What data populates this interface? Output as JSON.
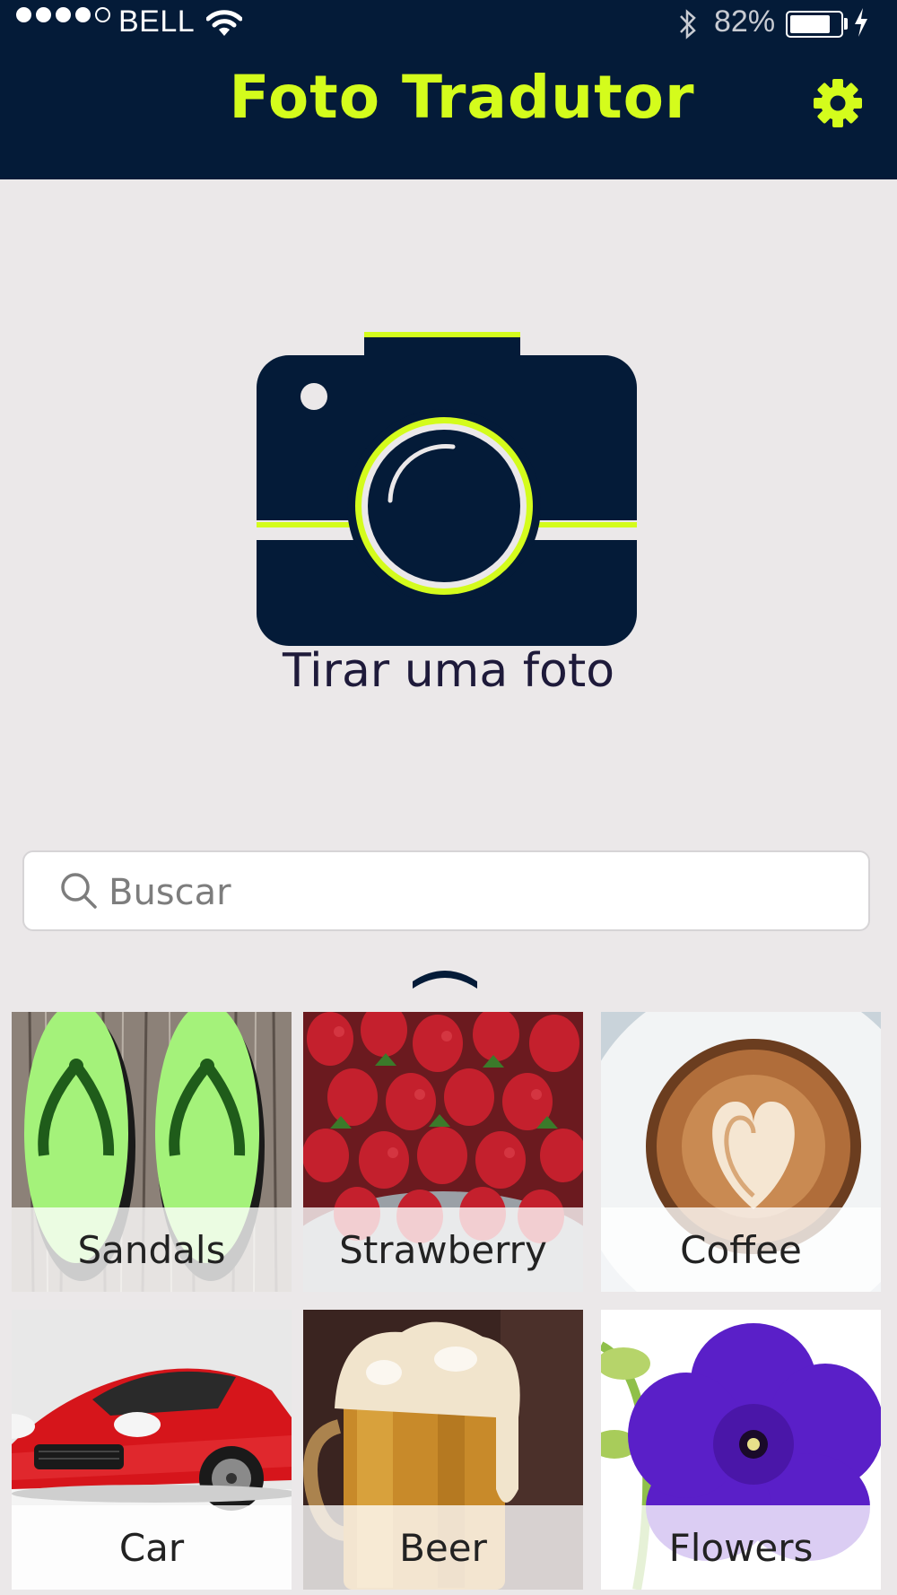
{
  "status_bar": {
    "carrier": "BELL",
    "battery_percent": "82%",
    "battery_level": 0.82,
    "signal_bars_filled": 4,
    "signal_bars_total": 5
  },
  "header": {
    "title": "Foto Tradutor",
    "settings_icon": "gear-icon"
  },
  "camera": {
    "icon": "camera-icon",
    "label": "Tirar uma foto"
  },
  "search": {
    "placeholder": "Buscar",
    "value": "",
    "icon": "search-icon"
  },
  "expand_icon": "chevron-up-icon",
  "categories": [
    {
      "label": "Sandals"
    },
    {
      "label": "Strawberry"
    },
    {
      "label": "Coffee"
    },
    {
      "label": "Car"
    },
    {
      "label": "Beer"
    },
    {
      "label": "Flowers"
    }
  ],
  "colors": {
    "navy": "#041b38",
    "accent": "#d4fc1c",
    "background": "#ebe8e9"
  }
}
